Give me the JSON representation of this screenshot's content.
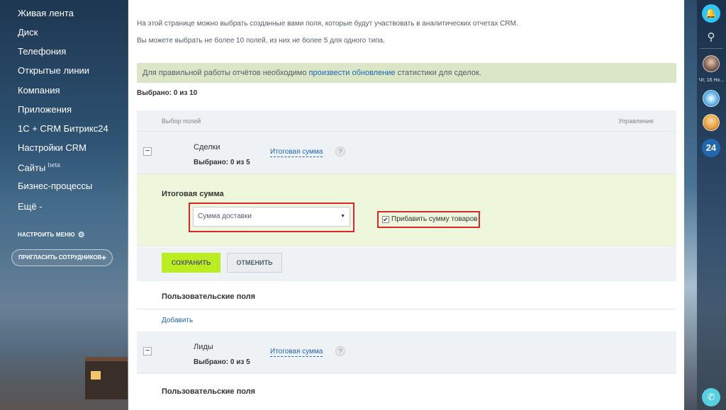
{
  "sidebar": {
    "items": [
      {
        "label": "Живая лента"
      },
      {
        "label": "Диск"
      },
      {
        "label": "Телефония"
      },
      {
        "label": "Открытые линии"
      },
      {
        "label": "Компания"
      },
      {
        "label": "Приложения"
      },
      {
        "label": "1С + CRM Битрикс24"
      },
      {
        "label": "Настройки CRM"
      },
      {
        "label": "Сайты",
        "badge": "beta"
      },
      {
        "label": "Бизнес-процессы"
      },
      {
        "label": "Ещё -"
      }
    ],
    "configure_menu": "НАСТРОИТЬ МЕНЮ",
    "invite_button": "ПРИГЛАСИТЬ СОТРУДНИКОВ",
    "invite_plus": "+"
  },
  "main": {
    "description_1": "На этой странице можно выбрать созданные вами поля, которые будут участвовать в аналитических отчетах CRM.",
    "description_2": "Вы можете выбрать не более 10 полей, из них не более 5 для одного типа.",
    "notice": {
      "prefix": "Для правильной работы отчётов необходимо ",
      "link": "произвести обновление",
      "suffix": " статистики для сделок."
    },
    "selected_total": "Выбрано: 0 из 10",
    "table_header": {
      "fields": "Выбор полей",
      "manage": "Управление"
    },
    "deals": {
      "toggle": "−",
      "name": "Сделки",
      "count": "Выбрано: 0 из 5",
      "link": "Итоговая сумма",
      "help": "?"
    },
    "edit_panel": {
      "title": "Итоговая сумма",
      "select_value": "Сумма доставки",
      "select_arrow": "▼",
      "checkbox_checked": true,
      "checkbox_mark": "✔",
      "checkbox_label": "Прибавить сумму товаров"
    },
    "actions": {
      "save": "СОХРАНИТЬ",
      "cancel": "ОТМЕНИТЬ"
    },
    "custom_fields_title": "Пользовательские поля",
    "add_link": "Добавить",
    "leads": {
      "toggle": "−",
      "name": "Лиды",
      "count": "Выбрано: 0 из 5",
      "link": "Итоговая сумма",
      "help": "?"
    },
    "custom_fields_title_2": "Пользовательские поля"
  },
  "right_panel": {
    "notifications_icon": "bell-icon",
    "search_icon": "search-icon",
    "date_label": "Чт, 16 Но...",
    "b24_label": "24",
    "phone_icon": "phone-icon"
  },
  "colors": {
    "accent_green": "#bbed21",
    "link_blue": "#2067b0",
    "notice_bg": "#dbe6c6",
    "highlight_red": "#d9272e",
    "bell_blue": "#2fc6f6"
  }
}
